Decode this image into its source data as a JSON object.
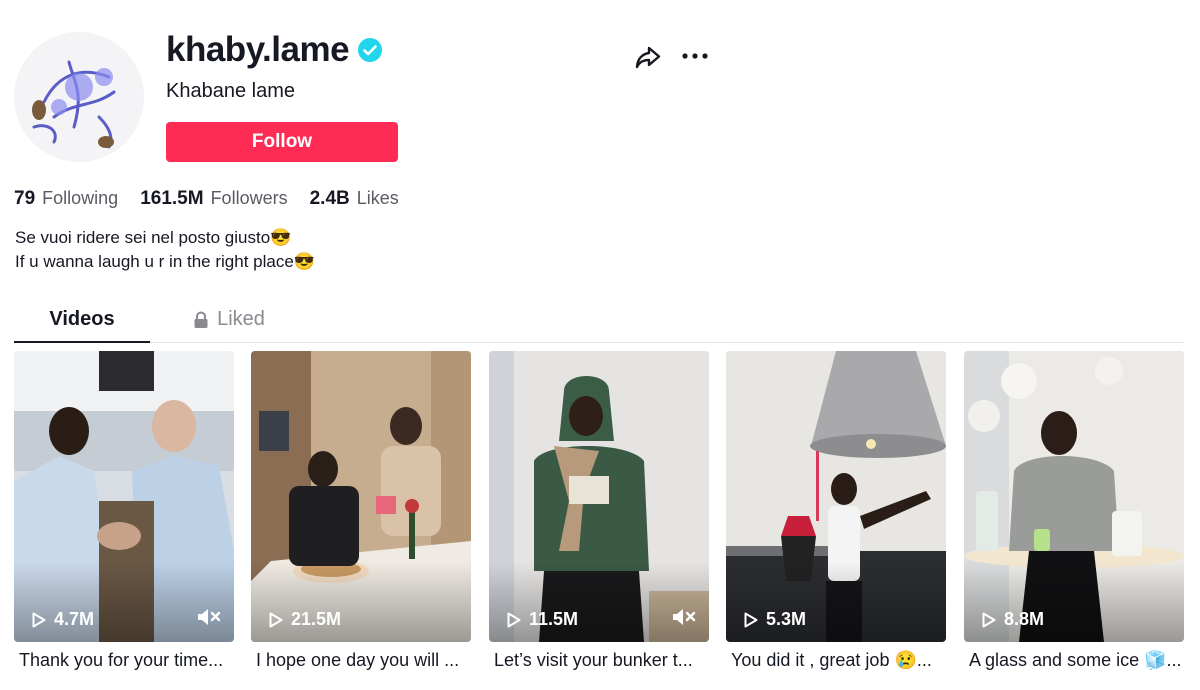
{
  "profile": {
    "username": "khaby.lame",
    "nickname": "Khabane lame",
    "follow_label": "Follow",
    "verified": true,
    "stats": [
      {
        "value": "79",
        "label": "Following"
      },
      {
        "value": "161.5M",
        "label": "Followers"
      },
      {
        "value": "2.4B",
        "label": "Likes"
      }
    ],
    "bio_lines": [
      "Se vuoi ridere sei nel posto giusto😎",
      "If u wanna laugh u r in the right place😎"
    ]
  },
  "header_icons": [
    "share-icon",
    "more-icon"
  ],
  "tabs": [
    {
      "label": "Videos",
      "active": true
    },
    {
      "label": "Liked",
      "active": false,
      "icon": "lock-icon"
    }
  ],
  "videos": [
    {
      "views": "4.7M",
      "caption": "Thank you for your time...",
      "muted": true
    },
    {
      "views": "21.5M",
      "caption": "I hope one day you will ...",
      "muted": false
    },
    {
      "views": "11.5M",
      "caption": "Let’s visit your bunker t...",
      "muted": true
    },
    {
      "views": "5.3M",
      "caption": "You did it , great job 😢...",
      "muted": false
    },
    {
      "views": "8.8M",
      "caption": "A glass and some ice 🧊...",
      "muted": false
    }
  ],
  "colors": {
    "accent": "#fe2c55",
    "verified": "#20d5ec",
    "text": "#161823",
    "muted_text": "#5a5b63"
  }
}
